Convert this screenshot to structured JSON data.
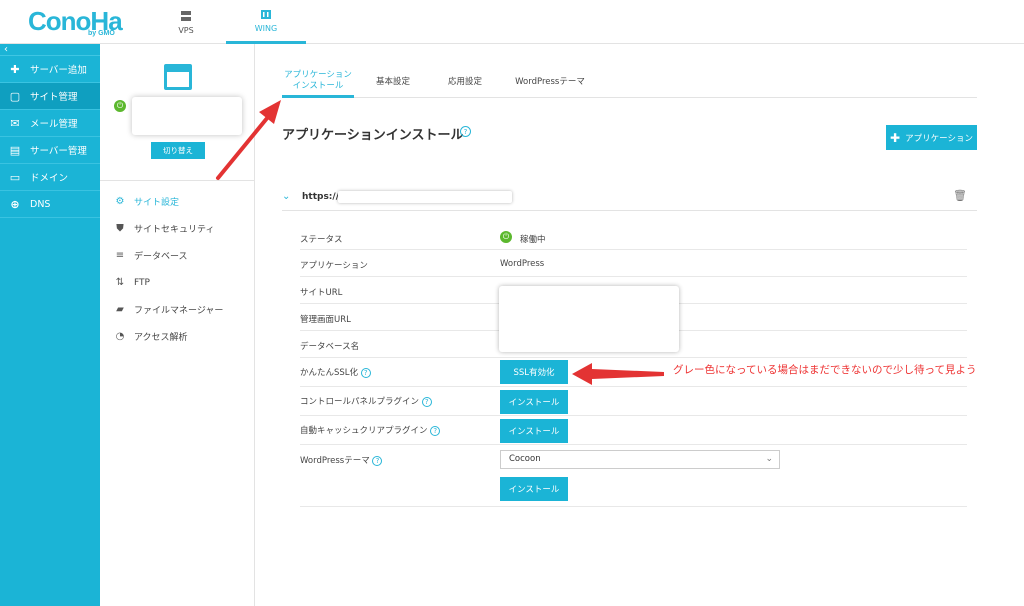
{
  "brand": {
    "name": "ConoHa",
    "sub": "by GMO"
  },
  "topnav": [
    {
      "label": "VPS"
    },
    {
      "label": "WING"
    }
  ],
  "sidebar": {
    "collapse": "‹",
    "items": [
      {
        "label": "サーバー追加",
        "icon": "plus-icon"
      },
      {
        "label": "サイト管理",
        "icon": "window-icon"
      },
      {
        "label": "メール管理",
        "icon": "mail-icon"
      },
      {
        "label": "サーバー管理",
        "icon": "server-icon"
      },
      {
        "label": "ドメイン",
        "icon": "domain-icon"
      },
      {
        "label": "DNS",
        "icon": "globe-icon"
      }
    ]
  },
  "site_panel": {
    "switch_label": "切り替え",
    "menu": [
      {
        "label": "サイト設定",
        "icon": "site-settings-icon"
      },
      {
        "label": "サイトセキュリティ",
        "icon": "shield-icon"
      },
      {
        "label": "データベース",
        "icon": "database-icon"
      },
      {
        "label": "FTP",
        "icon": "ftp-arrows-icon"
      },
      {
        "label": "ファイルマネージャー",
        "icon": "folder-icon"
      },
      {
        "label": "アクセス解析",
        "icon": "pie-chart-icon"
      }
    ]
  },
  "tabs": [
    {
      "line1": "アプリケーション",
      "line2": "インストール"
    },
    {
      "label": "基本設定"
    },
    {
      "label": "応用設定"
    },
    {
      "label": "WordPressテーマ"
    }
  ],
  "main": {
    "title": "アプリケーションインストール",
    "help": "?",
    "add_app_label": "アプリケーション",
    "url_prefix": "https://"
  },
  "details": {
    "status_label": "ステータス",
    "status_value": "稼働中",
    "app_label": "アプリケーション",
    "app_value": "WordPress",
    "site_url_label": "サイトURL",
    "admin_url_label": "管理画面URL",
    "db_name_label": "データベース名",
    "ssl_label": "かんたんSSL化",
    "ssl_button": "SSL有効化",
    "cp_plugin_label": "コントロールパネルプラグイン",
    "cp_plugin_button": "インストール",
    "cache_plugin_label": "自動キャッシュクリアプラグイン",
    "cache_plugin_button": "インストール",
    "theme_label": "WordPressテーマ",
    "theme_value": "Cocoon",
    "theme_button": "インストール"
  },
  "annotation": "グレー色になっている場合はまだできないので少し待って見よう",
  "colors": {
    "accent": "#1bb4d6",
    "status_green": "#5cb82e",
    "annotation_red": "#e33333"
  }
}
